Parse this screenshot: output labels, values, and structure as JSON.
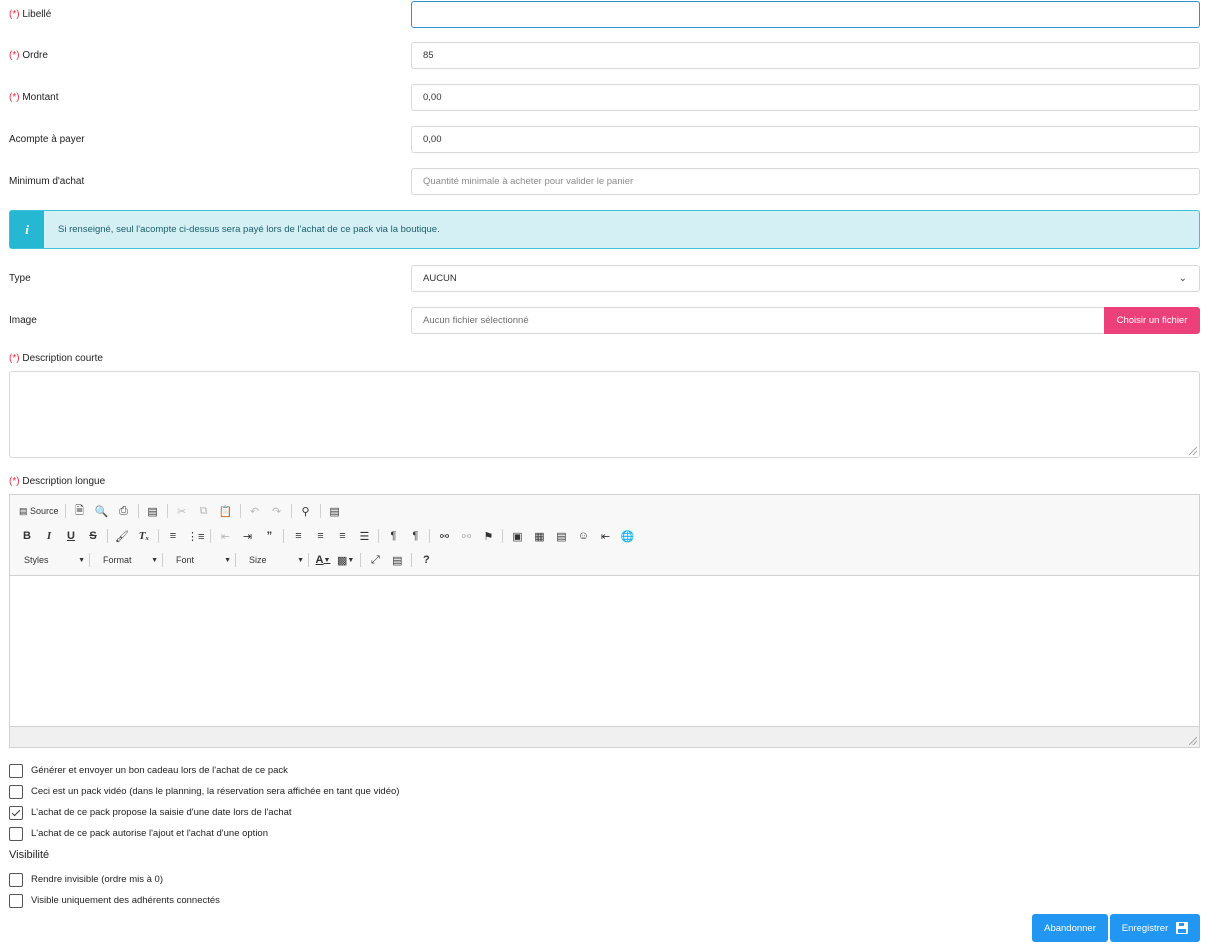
{
  "form": {
    "required_marker": "(*)",
    "libelle": {
      "label": "Libellé",
      "value": ""
    },
    "ordre": {
      "label": "Ordre",
      "value": "85"
    },
    "montant": {
      "label": "Montant",
      "value": "0,00"
    },
    "acompte": {
      "label": "Acompte à payer",
      "value": "0,00"
    },
    "minimum": {
      "label": "Minimum d'achat",
      "placeholder": "Quantité minimale à acheter pour valider le panier"
    },
    "info": {
      "icon": "info-icon",
      "text": "Si renseigné, seul l'acompte ci-dessus sera payé lors de l'achat de ce pack via la boutique."
    },
    "type": {
      "label": "Type",
      "selected": "AUCUN"
    },
    "image": {
      "label": "Image",
      "file_text": "Aucun fichier sélectionné",
      "button": "Choisir un fichier"
    },
    "short_desc": {
      "label": "Description courte"
    },
    "long_desc": {
      "label": "Description longue"
    }
  },
  "editor": {
    "source_label": "Source",
    "combos": {
      "styles": "Styles",
      "format": "Format",
      "font": "Font",
      "size": "Size"
    },
    "help": "?"
  },
  "options": [
    {
      "label": "Générer et envoyer un bon cadeau lors de l'achat de ce pack",
      "checked": false
    },
    {
      "label": "Ceci est un pack vidéo (dans le planning, la réservation sera affichée en tant que vidéo)",
      "checked": false
    },
    {
      "label": "L'achat de ce pack propose la saisie d'une date lors de l'achat",
      "checked": true
    },
    {
      "label": "L'achat de ce pack autorise l'ajout et l'achat d'une option",
      "checked": false
    }
  ],
  "visibility": {
    "title": "Visibilité",
    "options": [
      {
        "label": "Rendre invisible (ordre mis à 0)",
        "checked": false
      },
      {
        "label": "Visible uniquement des adhérents connectés",
        "checked": false
      }
    ]
  },
  "actions": {
    "cancel": "Abandonner",
    "save": "Enregistrer"
  },
  "colors": {
    "primary": "#2196f3",
    "file_button": "#ec407a",
    "info_bg": "#d4f0f5",
    "info_icon": "#26b8d2",
    "required": "#e0303a"
  }
}
